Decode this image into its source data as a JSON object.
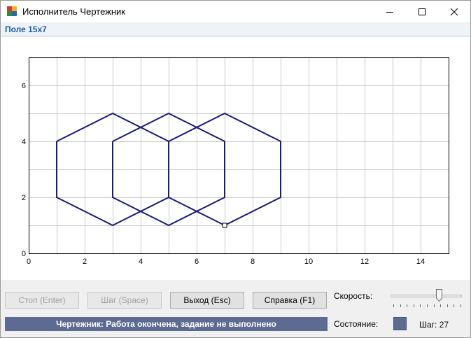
{
  "window": {
    "title": "Исполнитель Чертежник"
  },
  "menu": {
    "field_label": "Поле 15x7"
  },
  "plot": {
    "x_ticks": [
      "0",
      "2",
      "4",
      "6",
      "8",
      "10",
      "12",
      "14"
    ],
    "y_ticks": [
      "0",
      "2",
      "4",
      "6"
    ],
    "x_range": [
      0,
      15
    ],
    "y_range": [
      0,
      7
    ],
    "grid": true,
    "line_color": "#1a1a7a",
    "polylines": [
      [
        [
          1,
          4
        ],
        [
          3,
          5
        ],
        [
          5,
          4
        ],
        [
          5,
          2
        ],
        [
          3,
          1
        ],
        [
          1,
          2
        ],
        [
          1,
          4
        ]
      ],
      [
        [
          3,
          4
        ],
        [
          5,
          5
        ],
        [
          7,
          4
        ],
        [
          7,
          2
        ],
        [
          5,
          1
        ],
        [
          3,
          2
        ],
        [
          3,
          4
        ]
      ],
      [
        [
          5,
          4
        ],
        [
          7,
          5
        ],
        [
          9,
          4
        ],
        [
          9,
          2
        ],
        [
          7,
          1
        ],
        [
          5,
          2
        ],
        [
          5,
          4
        ]
      ]
    ],
    "cursor": [
      7,
      1
    ]
  },
  "buttons": {
    "stop": "Стоп (Enter)",
    "step": "Шаг (Space)",
    "exit": "Выход (Esc)",
    "help": "Справка (F1)"
  },
  "status": {
    "message": "Чертежник: Работа окончена, задание не выполнено",
    "speed_label": "Скорость:",
    "state_label": "Состояние:",
    "step_counter": "Шаг: 27",
    "state_color": "#5d6b92",
    "speed_level": 0.7
  }
}
